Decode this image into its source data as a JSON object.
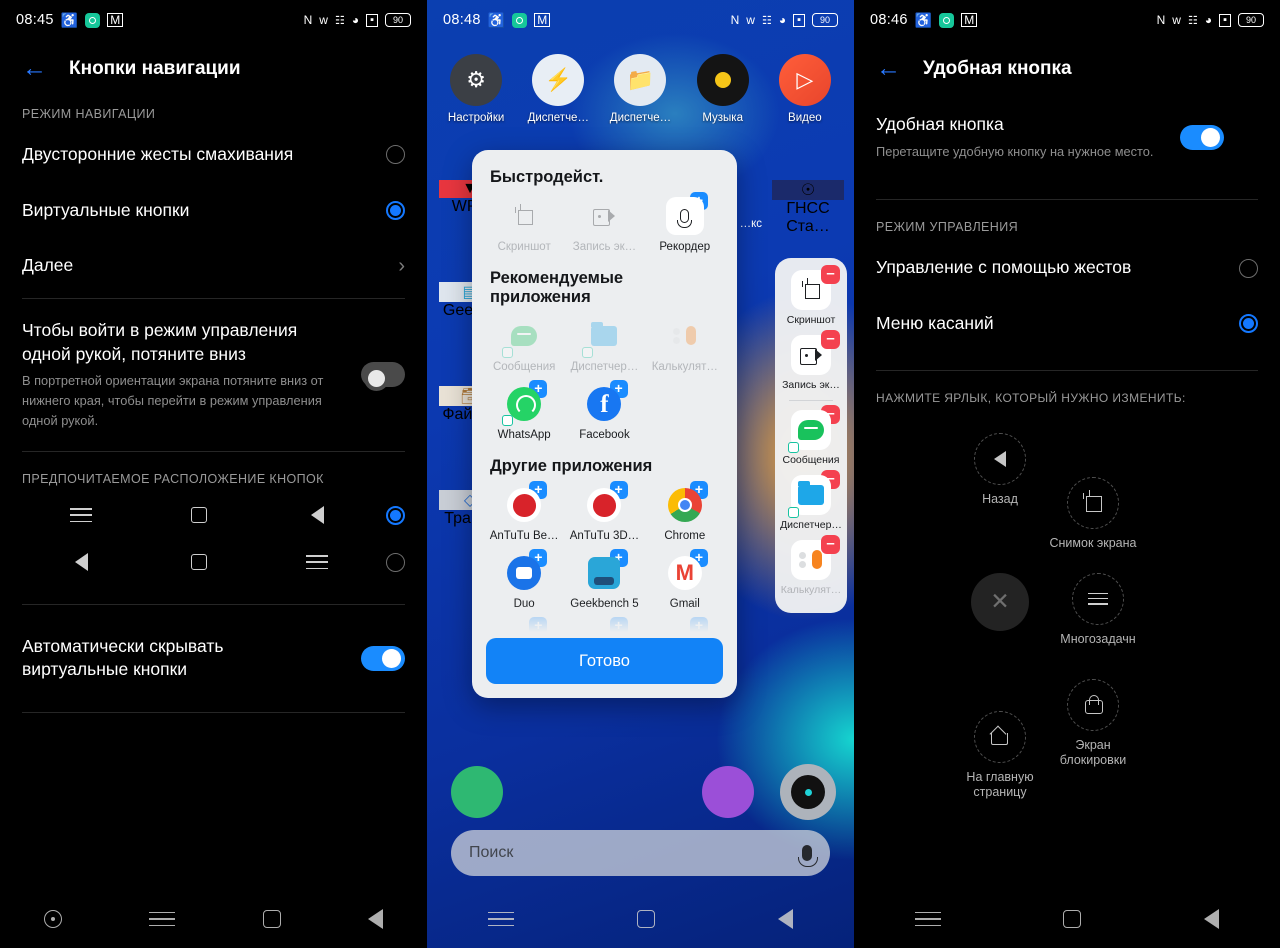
{
  "panel1": {
    "status": {
      "time": "08:45",
      "battery": "90",
      "left_icons": [
        "headphones-icon",
        "record-badge-icon",
        "mail-icon"
      ],
      "right_icons": [
        "nfc-icon",
        "bluetooth-icon",
        "vibrate-icon",
        "wifi-icon",
        "cast-icon",
        "battery-icon"
      ]
    },
    "title": "Кнопки навигации",
    "section_mode": "РЕЖИМ НАВИГАЦИИ",
    "options": [
      {
        "label": "Двусторонние жесты смахивания",
        "selected": false
      },
      {
        "label": "Виртуальные кнопки",
        "selected": true
      }
    ],
    "more_label": "Далее",
    "onehand": {
      "title": "Чтобы войти в режим управления одной рукой, потяните вниз",
      "sub": "В портретной ориентации экрана потяните вниз от нижнего края, чтобы перейти в режим управления одной рукой.",
      "enabled": false
    },
    "section_layout": "ПРЕДПОЧИТАЕМОЕ РАСПОЛОЖЕНИЕ КНОПОК",
    "layouts": [
      {
        "icons": [
          "menu-icon",
          "home-square-icon",
          "back-triangle-icon"
        ],
        "selected": true
      },
      {
        "icons": [
          "back-triangle-icon",
          "home-square-icon",
          "menu-icon"
        ],
        "selected": false
      }
    ],
    "autohide": {
      "label": "Автоматически скрывать виртуальные кнопки",
      "enabled": true
    },
    "navbar": [
      "assistant-dot-icon",
      "menu-icon",
      "home-square-icon",
      "back-triangle-icon"
    ]
  },
  "panel2": {
    "status": {
      "time": "08:48",
      "battery": "90"
    },
    "home_apps": [
      {
        "name": "Настройки",
        "icon": "settings-gear-icon"
      },
      {
        "name": "Диспетче…",
        "icon": "security-shield-icon"
      },
      {
        "name": "Диспетче…",
        "icon": "file-folder-icon"
      },
      {
        "name": "Музыка",
        "icon": "music-disc-icon"
      },
      {
        "name": "Видео",
        "icon": "video-play-icon"
      }
    ],
    "home_apps_left": [
      "WPS",
      "Geek…",
      "Файл…",
      "Тран…"
    ],
    "home_apps_right": [
      "…кс",
      "ГНСС Ста…"
    ],
    "dialog": {
      "header_quick": "Быстродейст.",
      "quick": [
        {
          "label": "Скриншот",
          "icon": "crop-screenshot-icon",
          "dim": true,
          "addable": false
        },
        {
          "label": "Запись эк…",
          "icon": "screen-record-icon",
          "dim": true,
          "addable": false
        },
        {
          "label": "Рекордер",
          "icon": "microphone-icon",
          "dim": false,
          "addable": true
        }
      ],
      "header_recommended": "Рекомендуемые приложения",
      "recommended": [
        {
          "label": "Сообщения",
          "icon": "messages-icon",
          "dim": true,
          "addable": false
        },
        {
          "label": "Диспетчер…",
          "icon": "file-folder-icon",
          "dim": true,
          "addable": false
        },
        {
          "label": "Калькулят…",
          "icon": "calculator-icon",
          "dim": true,
          "addable": false
        },
        {
          "label": "WhatsApp",
          "icon": "whatsapp-icon",
          "dim": false,
          "addable": true
        },
        {
          "label": "Facebook",
          "icon": "facebook-icon",
          "dim": false,
          "addable": true
        }
      ],
      "header_other": "Другие приложения",
      "other": [
        {
          "label": "AnTuTu Be…",
          "icon": "antutu-icon",
          "dim": false,
          "addable": true
        },
        {
          "label": "AnTuTu 3D…",
          "icon": "antutu-3d-icon",
          "dim": false,
          "addable": true
        },
        {
          "label": "Chrome",
          "icon": "chrome-icon",
          "dim": false,
          "addable": true
        },
        {
          "label": "Duo",
          "icon": "duo-icon",
          "dim": false,
          "addable": true
        },
        {
          "label": "Geekbench 5",
          "icon": "geekbench-icon",
          "dim": false,
          "addable": true
        },
        {
          "label": "Gmail",
          "icon": "gmail-icon",
          "dim": false,
          "addable": true
        }
      ],
      "done_label": "Готово",
      "add_glyph": "+"
    },
    "sidepanel": {
      "remove_glyph": "–",
      "items": [
        {
          "label": "Скриншот",
          "icon": "crop-screenshot-icon",
          "dim": false
        },
        {
          "label": "Запись эк…",
          "icon": "screen-record-icon",
          "dim": false
        },
        {
          "label": "Сообщения",
          "icon": "messages-icon",
          "dim": false
        },
        {
          "label": "Диспетчер…",
          "icon": "file-folder-icon",
          "dim": false
        },
        {
          "label": "Калькулят…",
          "icon": "calculator-icon",
          "dim": true
        }
      ]
    },
    "search": {
      "placeholder": "Поиск",
      "mic": "microphone-icon"
    },
    "navbar": [
      "menu-icon",
      "home-square-icon",
      "back-triangle-icon"
    ]
  },
  "panel3": {
    "status": {
      "time": "08:46",
      "battery": "90"
    },
    "title": "Удобная кнопка",
    "main_toggle": {
      "title": "Удобная кнопка",
      "sub": "Перетащите удобную кнопку на нужное место.",
      "enabled": true
    },
    "section_mode": "РЕЖИМ УПРАВЛЕНИЯ",
    "options": [
      {
        "label": "Управление с помощью жестов",
        "selected": false
      },
      {
        "label": "Меню касаний",
        "selected": true
      }
    ],
    "section_shortcuts": "НАЖМИТЕ ЯРЛЫК, КОТОРЫЙ НУЖНО ИЗМЕНИТЬ:",
    "shortcuts": [
      {
        "label": "Назад",
        "icon": "back-triangle-icon"
      },
      {
        "label": "Снимок экрана",
        "icon": "crop-screenshot-icon"
      },
      {
        "label": "Многозадачн",
        "icon": "menu-icon"
      },
      {
        "label": "Экран блокировки",
        "icon": "lock-icon"
      },
      {
        "label": "На главную страницу",
        "icon": "home-icon"
      }
    ],
    "close_glyph": "✕",
    "navbar": [
      "menu-icon",
      "home-square-icon",
      "back-triangle-icon"
    ]
  },
  "colors": {
    "accent_blue": "#1a8cff",
    "radio_blue": "#1478ff",
    "remove_red": "#f4414f",
    "add_blue": "#1a8cff",
    "done_blue": "#1283f7",
    "bg_black": "#000000",
    "dialog_bg": "#eceef0"
  }
}
